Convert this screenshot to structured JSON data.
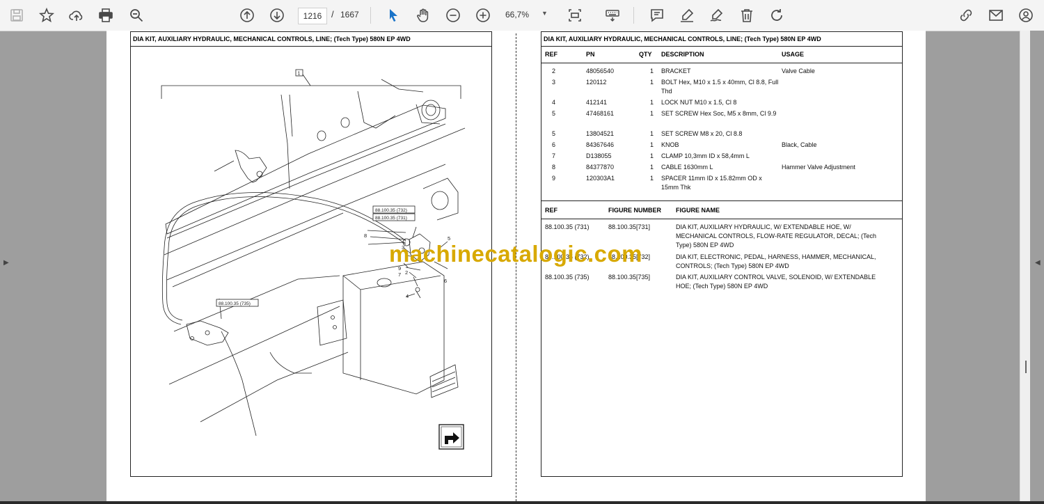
{
  "toolbar": {
    "page_current": "1216",
    "page_separator": "/",
    "page_total": "1667",
    "zoom_level": "66,7%"
  },
  "left_panel": {
    "title": "DIA KIT, AUXILIARY HYDRAULIC, MECHANICAL CONTROLS, LINE; (Tech Type) 580N EP 4WD",
    "callouts": {
      "c1": "1",
      "ref732": "88.100.35 (732)",
      "ref731": "88.100.35 (731)",
      "ref735": "88.100.35 (735)",
      "n8": "8",
      "n5": "5",
      "n3": "3",
      "n9": "9",
      "n7": "7",
      "n2": "2",
      "n6": "6",
      "n4": "4"
    }
  },
  "right_panel": {
    "title": "DIA KIT, AUXILIARY HYDRAULIC, MECHANICAL CONTROLS, LINE; (Tech Type) 580N EP 4WD",
    "parts_headers": {
      "ref": "REF",
      "pn": "PN",
      "qty": "QTY",
      "description": "DESCRIPTION",
      "usage": "USAGE"
    },
    "parts": [
      {
        "ref": "2",
        "pn": "48056540",
        "qty": "1",
        "description": "BRACKET",
        "usage": "Valve Cable"
      },
      {
        "ref": "3",
        "pn": "120112",
        "qty": "1",
        "description": "BOLT Hex, M10 x 1.5 x 40mm, Cl 8.8, Full Thd",
        "usage": ""
      },
      {
        "ref": "4",
        "pn": "412141",
        "qty": "1",
        "description": "LOCK NUT M10 x 1.5, Cl 8",
        "usage": ""
      },
      {
        "ref": "5",
        "pn": "47468161",
        "qty": "1",
        "description": "SET SCREW Hex Soc, M5 x 8mm, Cl 9.9",
        "usage": ""
      },
      {
        "ref": "5",
        "pn": "13804521",
        "qty": "1",
        "description": "SET SCREW M8 x 20, Cl 8.8",
        "usage": ""
      },
      {
        "ref": "6",
        "pn": "84367646",
        "qty": "1",
        "description": "KNOB",
        "usage": "Black, Cable"
      },
      {
        "ref": "7",
        "pn": "D138055",
        "qty": "1",
        "description": "CLAMP 10,3mm ID x 58,4mm L",
        "usage": ""
      },
      {
        "ref": "8",
        "pn": "84377870",
        "qty": "1",
        "description": "CABLE 1630mm L",
        "usage": "Hammer Valve Adjustment"
      },
      {
        "ref": "9",
        "pn": "120303A1",
        "qty": "1",
        "description": "SPACER 11mm ID x 15.82mm OD x 15mm Thk",
        "usage": ""
      }
    ],
    "figure_headers": {
      "ref": "REF",
      "figure_number": "FIGURE NUMBER",
      "figure_name": "FIGURE NAME"
    },
    "figures": [
      {
        "ref": "88.100.35 (731)",
        "figure_number": "88.100.35[731]",
        "figure_name": "DIA KIT, AUXILIARY HYDRAULIC, W/ EXTENDABLE HOE, W/ MECHANICAL CONTROLS, FLOW-RATE REGULATOR, DECAL; (Tech Type) 580N EP 4WD"
      },
      {
        "ref": "88.100.35 (732)",
        "figure_number": "88.100.35[732]",
        "figure_name": "DIA KIT, ELECTRONIC, PEDAL, HARNESS, HAMMER, MECHANICAL, CONTROLS; (Tech Type) 580N EP 4WD"
      },
      {
        "ref": "88.100.35 (735)",
        "figure_number": "88.100.35[735]",
        "figure_name": "DIA KIT, AUXILIARY CONTROL VALVE, SOLENOID, W/ EXTENDABLE HOE; (Tech Type) 580N EP 4WD"
      }
    ]
  },
  "watermark": "machinecatalogic.com",
  "colors": {
    "watermark": "#d8a900",
    "toolbar_bg": "#f4f4f4",
    "viewer_bg": "#9e9e9e",
    "accent": "#1a73c8"
  }
}
